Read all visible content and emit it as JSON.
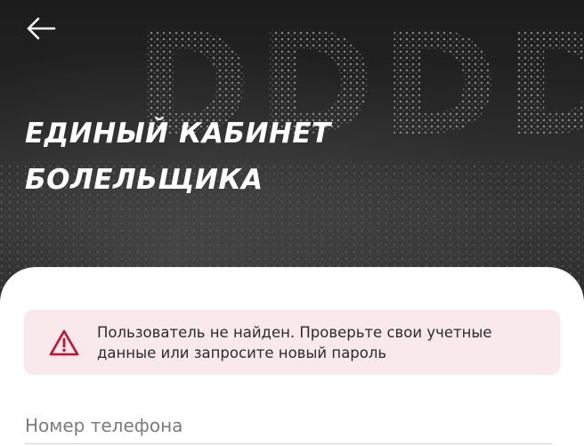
{
  "hero": {
    "title_line1": "ЕДИНЫЙ КАБИНЕТ",
    "title_line2": "БОЛЕЛЬЩИКА",
    "background_word": "DDDDЛ"
  },
  "nav": {
    "back_icon": "arrow-left-icon"
  },
  "alert": {
    "icon": "warning-triangle-icon",
    "message": "Пользователь не найден. Проверьте свои учетные данные или запросите новый пароль",
    "accent_color": "#c8102e",
    "background_color": "#f9e9eb"
  },
  "form": {
    "phone_label": "Номер телефона"
  }
}
